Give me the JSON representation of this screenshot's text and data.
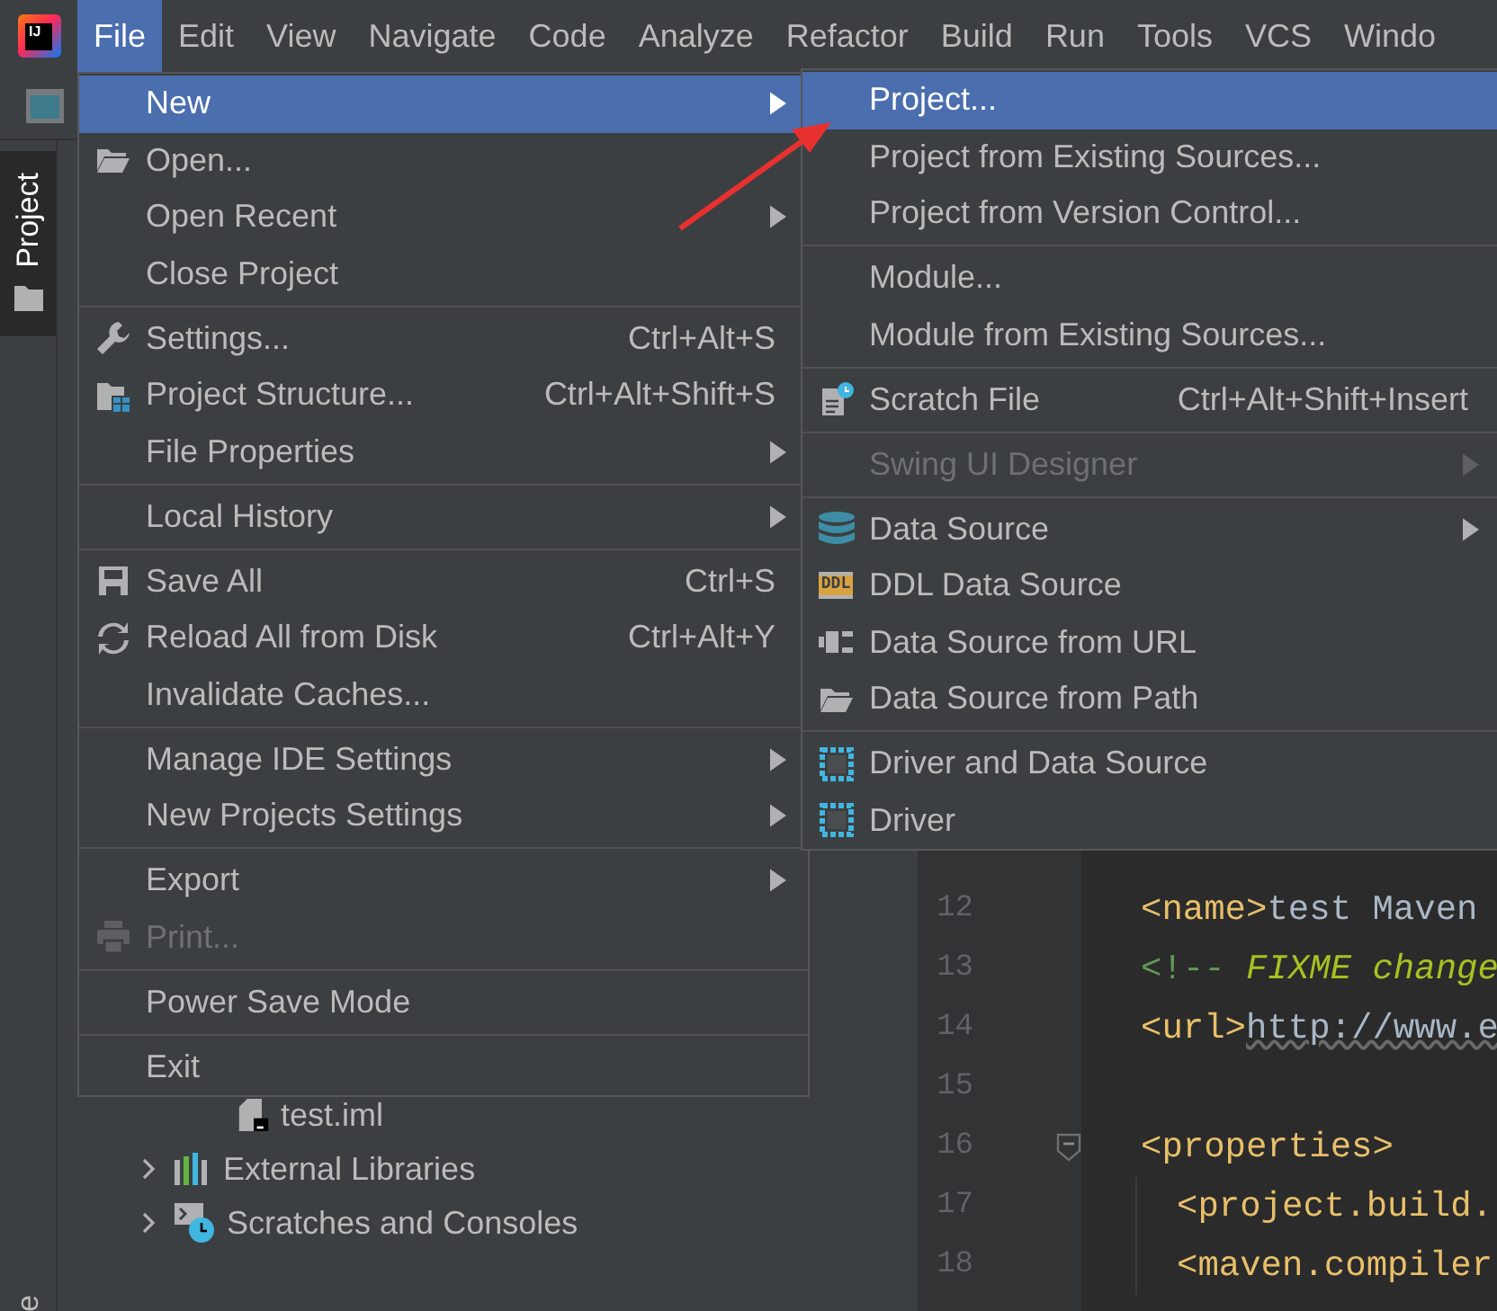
{
  "app_logo": "IJ",
  "menubar": [
    {
      "label": "File",
      "selected": true
    },
    {
      "label": "Edit",
      "selected": false
    },
    {
      "label": "View",
      "selected": false
    },
    {
      "label": "Navigate",
      "selected": false
    },
    {
      "label": "Code",
      "selected": false
    },
    {
      "label": "Analyze",
      "selected": false
    },
    {
      "label": "Refactor",
      "selected": false
    },
    {
      "label": "Build",
      "selected": false
    },
    {
      "label": "Run",
      "selected": false
    },
    {
      "label": "Tools",
      "selected": false
    },
    {
      "label": "VCS",
      "selected": false
    },
    {
      "label": "Windo",
      "selected": false
    }
  ],
  "tool_window_tab": {
    "label": "Project",
    "selected": true
  },
  "bottom_tool_tab": {
    "label": "e"
  },
  "project_tree": [
    {
      "kind": "file",
      "label": "test.iml"
    },
    {
      "kind": "libraries",
      "label": "External Libraries",
      "expanded": false
    },
    {
      "kind": "scratches",
      "label": "Scratches and Consoles",
      "expanded": false
    }
  ],
  "editor": {
    "lines": [
      {
        "number": "12",
        "fold": false,
        "indented": false,
        "tokens": [
          {
            "kind": "tag",
            "text": "<name>"
          },
          {
            "kind": "text",
            "text": "test Maven"
          }
        ]
      },
      {
        "number": "13",
        "fold": false,
        "indented": false,
        "tokens": [
          {
            "kind": "comment",
            "text": "<!-- "
          },
          {
            "kind": "todo",
            "text": "FIXME change"
          }
        ]
      },
      {
        "number": "14",
        "fold": false,
        "indented": false,
        "tokens": [
          {
            "kind": "tag",
            "text": "<url>"
          },
          {
            "kind": "link",
            "text": "http://www.e"
          }
        ]
      },
      {
        "number": "15",
        "fold": false
      },
      {
        "number": "16",
        "fold": true,
        "indented": false,
        "tokens": [
          {
            "kind": "tag",
            "text": "<properties>"
          }
        ]
      },
      {
        "number": "17",
        "fold": false,
        "indented": true,
        "tokens": [
          {
            "kind": "tag",
            "text": "<project.build."
          }
        ]
      },
      {
        "number": "18",
        "fold": false,
        "indented": true,
        "tokens": [
          {
            "kind": "tag",
            "text": "<maven.compiler"
          }
        ]
      }
    ]
  },
  "file_menu": {
    "items": [
      {
        "kind": "item",
        "label": "New",
        "selected": true,
        "disabled": false,
        "submenu": true
      },
      {
        "kind": "item",
        "label": "Open...",
        "selected": false,
        "disabled": false,
        "submenu": false
      },
      {
        "kind": "item",
        "label": "Open Recent",
        "selected": false,
        "disabled": false,
        "submenu": true
      },
      {
        "kind": "item",
        "label": "Close Project",
        "selected": false,
        "disabled": false,
        "submenu": false
      },
      {
        "kind": "separator"
      },
      {
        "kind": "item",
        "label": "Settings...",
        "shortcut": "Ctrl+Alt+S",
        "selected": false,
        "disabled": false,
        "submenu": false
      },
      {
        "kind": "item",
        "label": "Project Structure...",
        "shortcut": "Ctrl+Alt+Shift+S",
        "selected": false,
        "disabled": false,
        "submenu": false
      },
      {
        "kind": "item",
        "label": "File Properties",
        "selected": false,
        "disabled": false,
        "submenu": true
      },
      {
        "kind": "separator"
      },
      {
        "kind": "item",
        "label": "Local History",
        "selected": false,
        "disabled": false,
        "submenu": true
      },
      {
        "kind": "separator"
      },
      {
        "kind": "item",
        "label": "Save All",
        "shortcut": "Ctrl+S",
        "selected": false,
        "disabled": false,
        "submenu": false
      },
      {
        "kind": "item",
        "label": "Reload All from Disk",
        "shortcut": "Ctrl+Alt+Y",
        "selected": false,
        "disabled": false,
        "submenu": false
      },
      {
        "kind": "item",
        "label": "Invalidate Caches...",
        "selected": false,
        "disabled": false,
        "submenu": false
      },
      {
        "kind": "separator"
      },
      {
        "kind": "item",
        "label": "Manage IDE Settings",
        "selected": false,
        "disabled": false,
        "submenu": true
      },
      {
        "kind": "item",
        "label": "New Projects Settings",
        "selected": false,
        "disabled": false,
        "submenu": true
      },
      {
        "kind": "separator"
      },
      {
        "kind": "item",
        "label": "Export",
        "selected": false,
        "disabled": false,
        "submenu": true
      },
      {
        "kind": "item",
        "label": "Print...",
        "selected": false,
        "disabled": true,
        "submenu": false
      },
      {
        "kind": "separator"
      },
      {
        "kind": "item",
        "label": "Power Save Mode",
        "selected": false,
        "disabled": false,
        "submenu": false
      },
      {
        "kind": "separator"
      },
      {
        "kind": "item",
        "label": "Exit",
        "selected": false,
        "disabled": false,
        "submenu": false
      }
    ]
  },
  "new_submenu": {
    "items": [
      {
        "kind": "item",
        "label": "Project...",
        "selected": true,
        "disabled": false,
        "submenu": false
      },
      {
        "kind": "item",
        "label": "Project from Existing Sources...",
        "selected": false,
        "disabled": false,
        "submenu": false
      },
      {
        "kind": "item",
        "label": "Project from Version Control...",
        "selected": false,
        "disabled": false,
        "submenu": false
      },
      {
        "kind": "separator"
      },
      {
        "kind": "item",
        "label": "Module...",
        "selected": false,
        "disabled": false,
        "submenu": false
      },
      {
        "kind": "item",
        "label": "Module from Existing Sources...",
        "selected": false,
        "disabled": false,
        "submenu": false
      },
      {
        "kind": "separator"
      },
      {
        "kind": "item",
        "label": "Scratch File",
        "shortcut": "Ctrl+Alt+Shift+Insert",
        "selected": false,
        "disabled": false,
        "submenu": false
      },
      {
        "kind": "separator"
      },
      {
        "kind": "item",
        "label": "Swing UI Designer",
        "selected": false,
        "disabled": true,
        "submenu": true
      },
      {
        "kind": "separator"
      },
      {
        "kind": "item",
        "label": "Data Source",
        "selected": false,
        "disabled": false,
        "submenu": true
      },
      {
        "kind": "item",
        "label": "DDL Data Source",
        "badge": "DDL",
        "selected": false,
        "disabled": false,
        "submenu": false
      },
      {
        "kind": "item",
        "label": "Data Source from URL",
        "selected": false,
        "disabled": false,
        "submenu": false
      },
      {
        "kind": "item",
        "label": "Data Source from Path",
        "selected": false,
        "disabled": false,
        "submenu": false
      },
      {
        "kind": "separator"
      },
      {
        "kind": "item",
        "label": "Driver and Data Source",
        "selected": false,
        "disabled": false,
        "submenu": false
      },
      {
        "kind": "item",
        "label": "Driver",
        "selected": false,
        "disabled": false,
        "submenu": false
      }
    ]
  }
}
